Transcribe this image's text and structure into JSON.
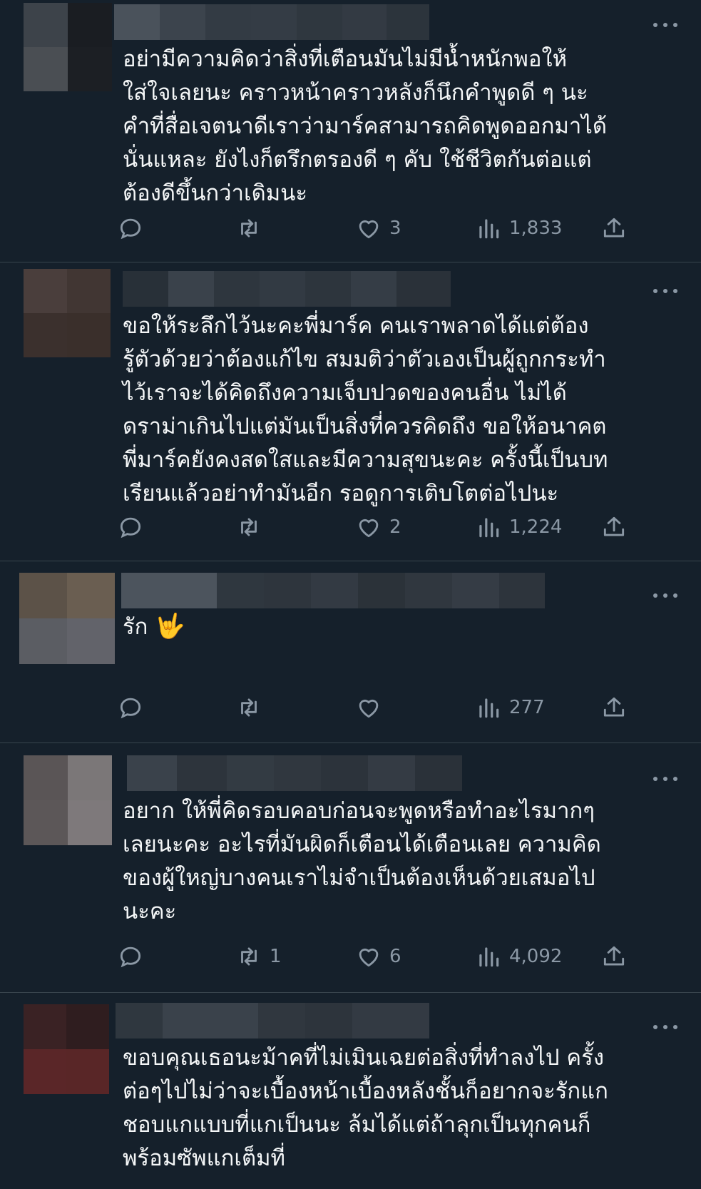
{
  "posts": [
    {
      "text": "อย่ามีความคิดว่าสิ่งที่เตือนมันไม่มีน้ำหนักพอให้\nใส่ใจเลยนะ คราวหน้าคราวหลังก็นึกคำพูดดี ๆ นะ\nคำที่สื่อเจตนาดีเราว่ามาร์คสามารถคิดพูดออกมาได้\nนั่นแหละ ยังไงก็ตรึกตรองดี ๆ คับ ใช้ชีวิตกันต่อแต่\nต้องดีขึ้นกว่าเดิมนะ",
      "replies": "",
      "retweets": "",
      "likes": "3",
      "views": "1,833"
    },
    {
      "text": "ขอให้ระลึกไว้นะคะพี่มาร์ค คนเราพลาดได้แต่ต้อง\nรู้ตัวด้วยว่าต้องแก้ไข สมมติว่าตัวเองเป็นผู้ถูกกระทำ\nไว้เราจะได้คิดถึงความเจ็บปวดของคนอื่น ไม่ได้\nดราม่าเกินไปแต่มันเป็นสิ่งที่ควรคิดถึง ขอให้อนาคต\nพี่มาร์คยังคงสดใสและมีความสุขนะคะ ครั้งนี้เป็นบท\nเรียนแล้วอย่าทำมันอีก รอดูการเติบโตต่อไปนะ",
      "replies": "",
      "retweets": "",
      "likes": "2",
      "views": "1,224"
    },
    {
      "text": "รัก",
      "emoji": "🤟",
      "replies": "",
      "retweets": "",
      "likes": "",
      "views": "277"
    },
    {
      "text": "อยาก ให้พี่คิดรอบคอบก่อนจะพูดหรือทำอะไรมากๆ\nเลยนะคะ อะไรที่มันผิดก็เตือนได้เตือนเลย ความคิด\nของผู้ใหญ่บางคนเราไม่จำเป็นต้องเห็นด้วยเสมอไป\nนะคะ",
      "replies": "",
      "retweets": "1",
      "likes": "6",
      "views": "4,092"
    },
    {
      "text": "ขอบคุณเธอนะม้าคที่ไม่เมินเฉยต่อสิ่งที่ทำลงไป ครั้ง\nต่อๆไปไม่ว่าจะเบื้องหน้าเบื้องหลังชั้นก็อยากจะรักแก\nชอบแกแบบที่แกเป็นนะ ล้มได้แต่ถ้าลุกเป็นทุกคนก็\nพร้อมซัพแกเต็มที่"
    }
  ],
  "icons": {
    "reply": "reply-bubble-icon",
    "retweet": "retweet-arrows-icon",
    "like": "heart-icon",
    "views": "bar-chart-icon",
    "share": "share-upload-icon",
    "more": "more-dots-icon"
  },
  "colors": {
    "background": "#15202b",
    "text": "#ffffff",
    "secondary": "#8b98a5",
    "divider": "#38444d"
  }
}
